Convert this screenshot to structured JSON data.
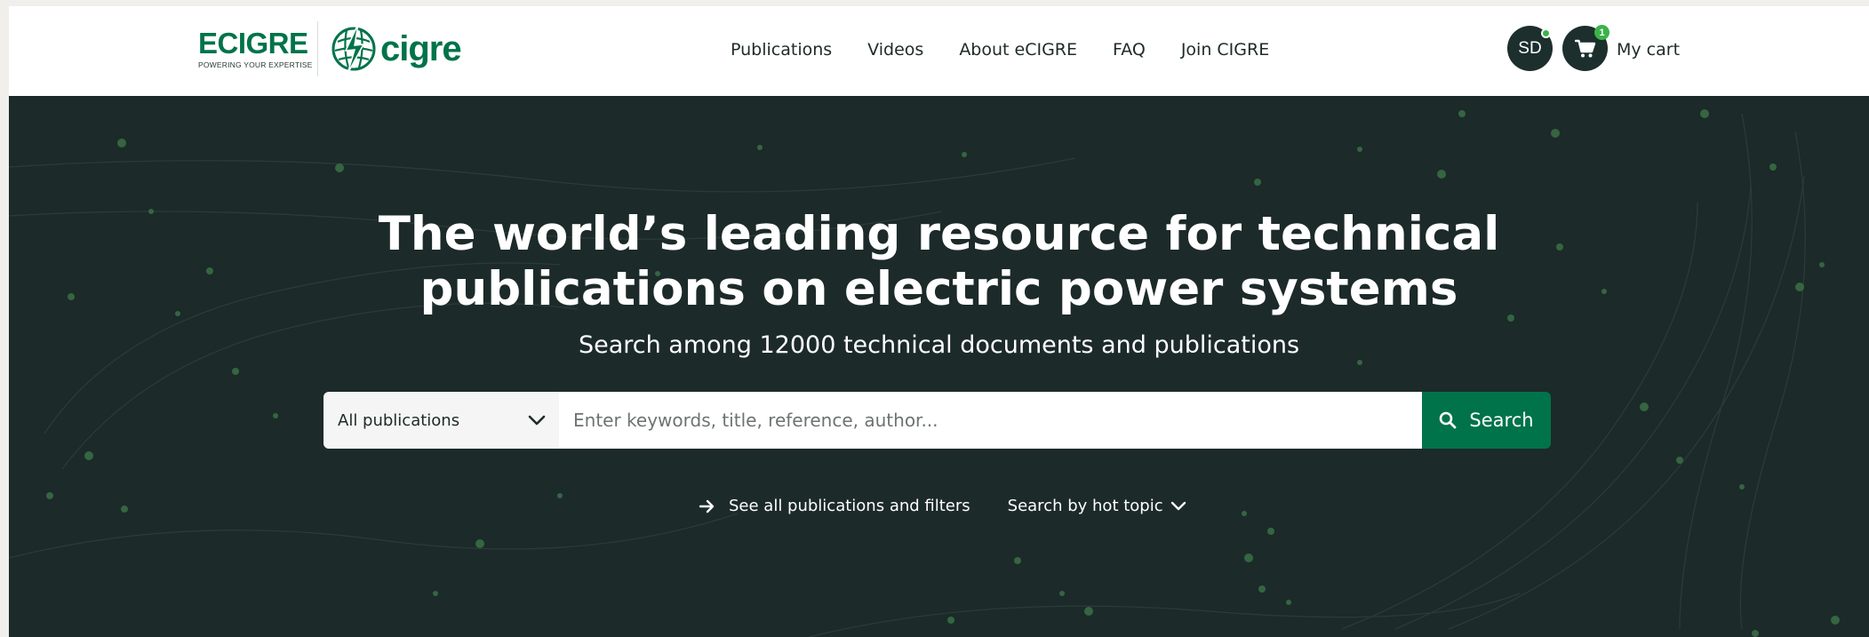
{
  "header": {
    "logo": {
      "brand": "ECIGRE",
      "tagline": "POWERING YOUR EXPERTISE",
      "partner": "cigre"
    },
    "nav": [
      {
        "label": "Publications",
        "name": "nav-publications"
      },
      {
        "label": "Videos",
        "name": "nav-videos"
      },
      {
        "label": "About eCIGRE",
        "name": "nav-about"
      },
      {
        "label": "FAQ",
        "name": "nav-faq"
      },
      {
        "label": "Join CIGRE",
        "name": "nav-join"
      }
    ],
    "user": {
      "initials": "SD",
      "status_color": "#3ab34a"
    },
    "cart": {
      "label": "My cart",
      "count": "1",
      "icon": "cart-icon"
    }
  },
  "hero": {
    "title_line1": "The world’s leading resource for technical",
    "title_line2": "publications on electric power systems",
    "subtitle": "Search among 12000 technical documents and publications",
    "search": {
      "scope_selected": "All publications",
      "placeholder": "Enter keywords, title, reference, author...",
      "button_label": "Search",
      "button_icon": "search-icon"
    },
    "links": {
      "see_all": "See all publications and filters",
      "see_all_icon": "arrow-right-icon",
      "hot_topic": "Search by hot topic",
      "hot_topic_icon": "chevron-down-icon"
    }
  },
  "colors": {
    "brand_green": "#00734a",
    "hero_bg": "#1c2a29",
    "avatar_bg": "#1c2f2c",
    "accent_green": "#3ab34a"
  }
}
